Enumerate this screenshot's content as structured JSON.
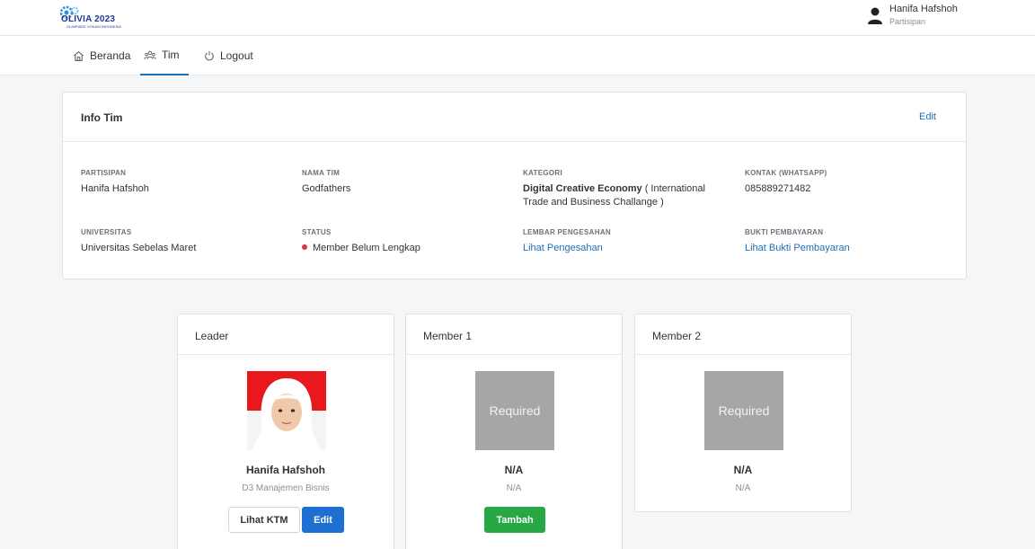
{
  "header": {
    "logo_text": "OLIVIA 2023",
    "logo_subtext": "OLIMPIADE VOKASI INDONESIA",
    "user_name": "Hanifa Hafshoh",
    "user_role": "Partisipan"
  },
  "nav": {
    "items": [
      {
        "label": "Beranda"
      },
      {
        "label": "Tim"
      },
      {
        "label": "Logout"
      }
    ]
  },
  "info": {
    "title": "Info Tim",
    "edit_label": "Edit",
    "fields": {
      "partisipan": {
        "label": "PARTISIPAN",
        "value": "Hanifa Hafshoh"
      },
      "nama_tim": {
        "label": "NAMA TIM",
        "value": "Godfathers"
      },
      "kategori": {
        "label": "KATEGORI",
        "value_bold": "Digital Creative Economy",
        "value_rest": " ( International Trade and Business Challange )"
      },
      "kontak": {
        "label": "KONTAK (WHATSAPP)",
        "value": "085889271482"
      },
      "universitas": {
        "label": "UNIVERSITAS",
        "value": "Universitas Sebelas Maret"
      },
      "status": {
        "label": "STATUS",
        "value": "Member Belum Lengkap",
        "color": "#dc3545"
      },
      "lembar": {
        "label": "LEMBAR PENGESAHAN",
        "value": "Lihat Pengesahan"
      },
      "bukti": {
        "label": "BUKTI PEMBAYARAN",
        "value": "Lihat Bukti Pembayaran"
      }
    }
  },
  "members": [
    {
      "title": "Leader",
      "name": "Hanifa Hafshoh",
      "program": "D3 Manajemen Bisnis",
      "btn_ktm": "Lihat KTM",
      "btn_edit": "Edit"
    },
    {
      "title": "Member 1",
      "placeholder": "Required",
      "name": "N/A",
      "program": "N/A",
      "btn_add": "Tambah"
    },
    {
      "title": "Member 2",
      "placeholder": "Required",
      "name": "N/A",
      "program": "N/A"
    }
  ],
  "colors": {
    "accent": "#1d6fb8",
    "primary_button": "#1d6fd1",
    "success_button": "#28a745",
    "placeholder_gray": "#a6a6a6"
  }
}
